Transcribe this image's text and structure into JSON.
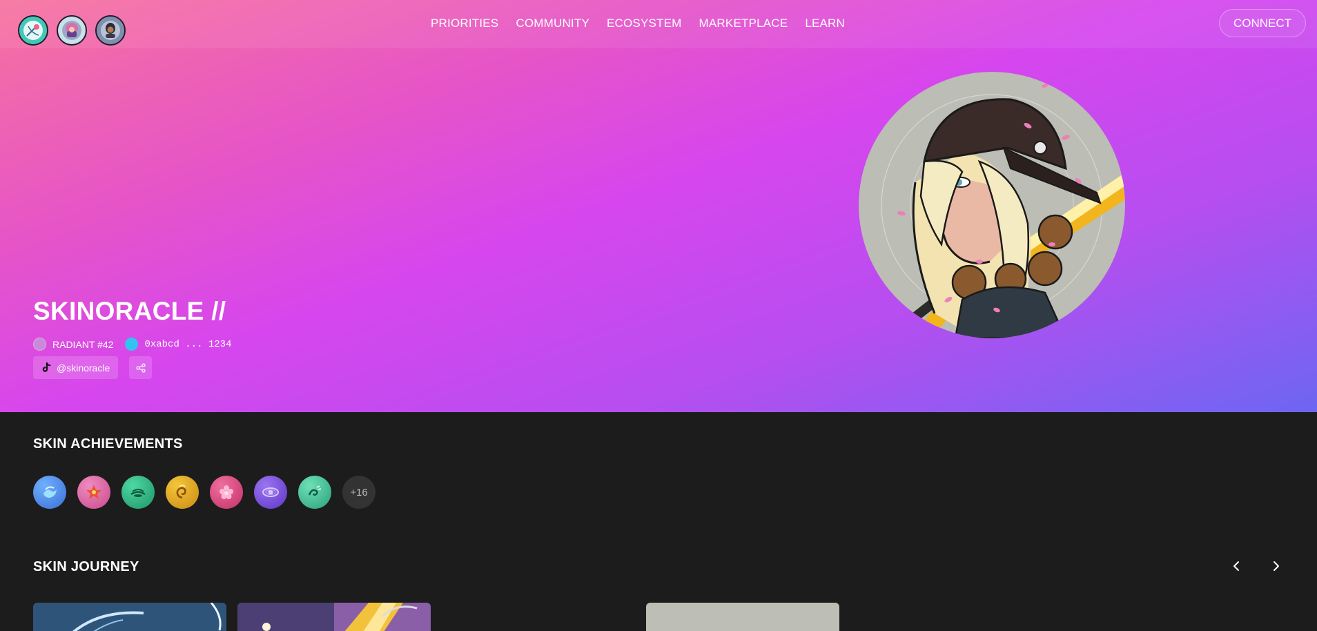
{
  "header": {
    "avatars": [
      {
        "name": "avatar-archer-icon",
        "color": "#3fc9b8"
      },
      {
        "name": "avatar-pink-hair-icon",
        "color": "#c7e3ea"
      },
      {
        "name": "avatar-dark-icon",
        "color": "#7f8fb0"
      }
    ],
    "nav": [
      "PRIORITIES",
      "COMMUNITY",
      "ECOSYSTEM",
      "MARKETPLACE",
      "LEARN"
    ],
    "connect_label": "CONNECT"
  },
  "profile": {
    "name": "SKINORACLE //",
    "rank": "RADIANT #42",
    "rank_color": "#c98ad9",
    "wallet": "0xabcd ... 1234",
    "wallet_color": "#32c4f0",
    "social_handle": "@skinoracle",
    "social_icon": "tiktok-icon",
    "share_icon": "share-icon"
  },
  "achievements": {
    "title": "SKIN ACHIEVEMENTS",
    "badges": [
      {
        "name": "water-badge-icon",
        "color": "#3f7fd9"
      },
      {
        "name": "star-badge-icon",
        "color": "#d85a9e"
      },
      {
        "name": "lotus-badge-icon",
        "color": "#25a877"
      },
      {
        "name": "swirl-badge-icon",
        "color": "#d9a21c"
      },
      {
        "name": "flower-badge-icon",
        "color": "#d6427c"
      },
      {
        "name": "eye-badge-icon",
        "color": "#7c4fd8"
      },
      {
        "name": "wave-badge-icon",
        "color": "#3fb98b"
      }
    ],
    "more_count": "+16"
  },
  "journey": {
    "title": "SKIN JOURNEY",
    "prev_icon": "chevron-left-icon",
    "next_icon": "chevron-right-icon"
  }
}
